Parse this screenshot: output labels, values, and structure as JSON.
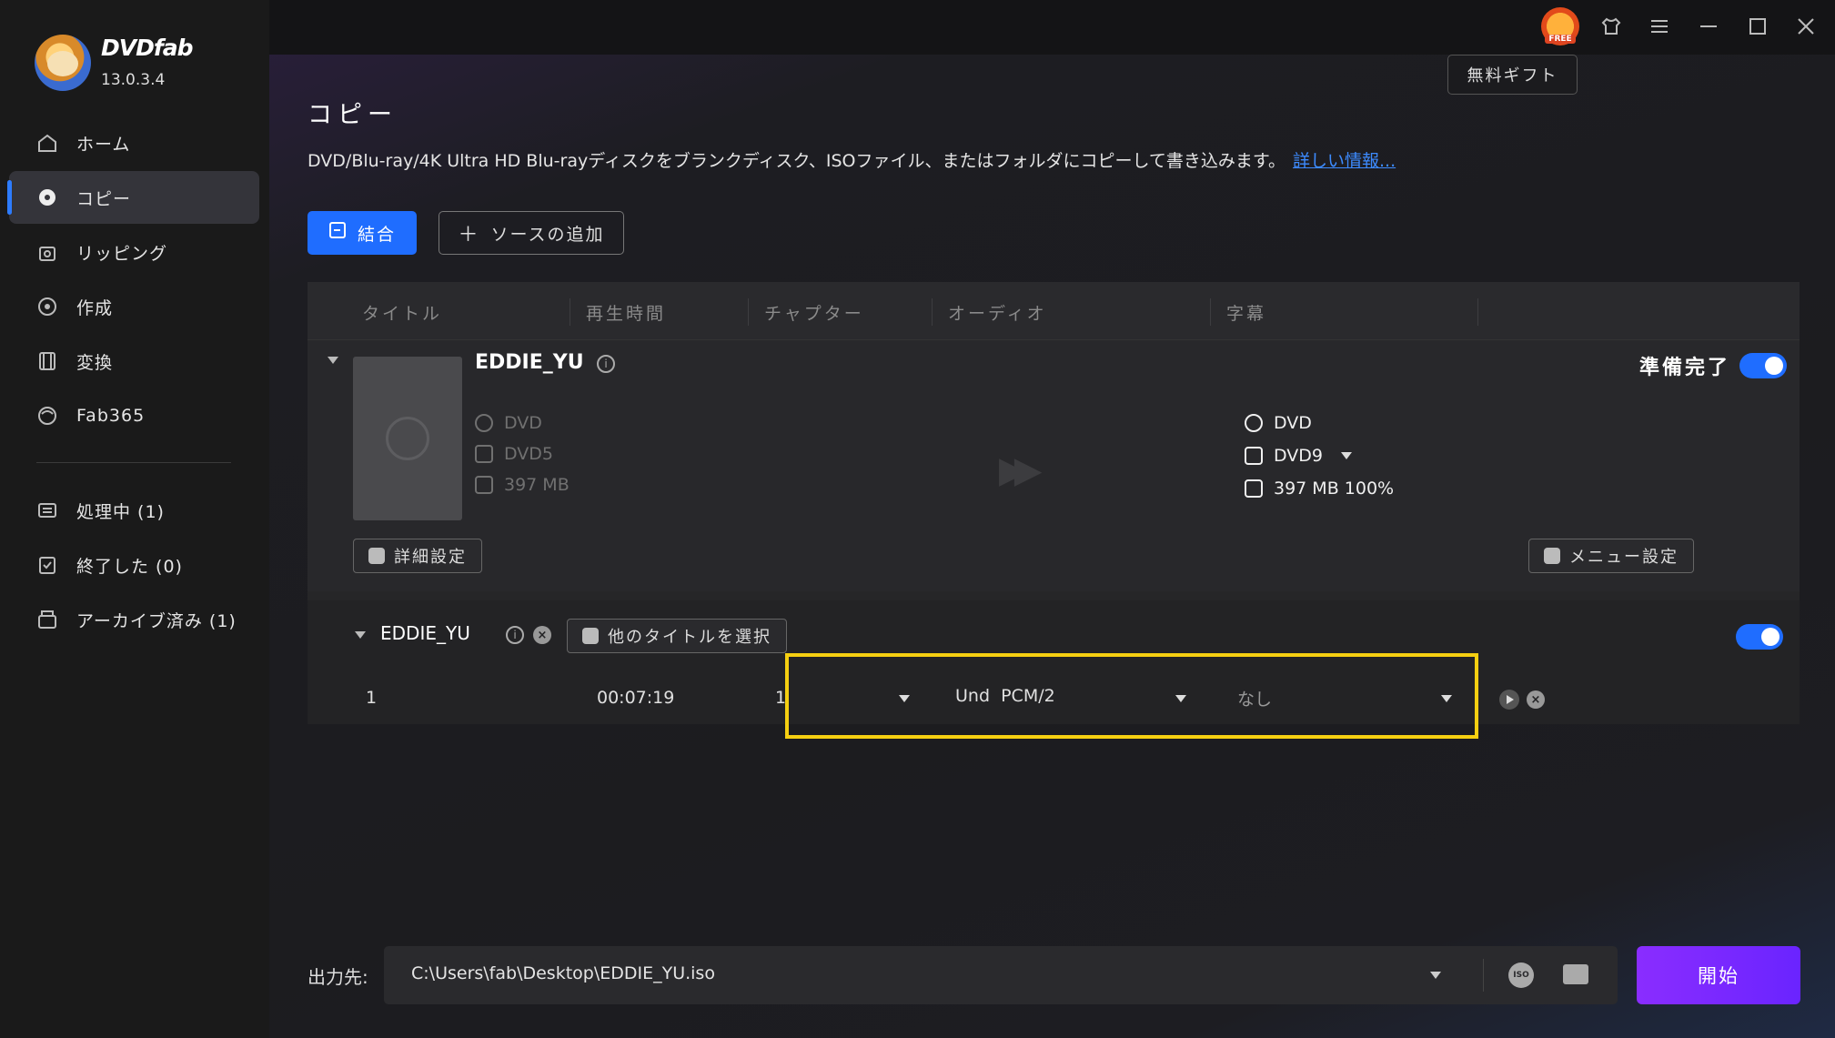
{
  "app": {
    "brand": "DVDfab",
    "version": "13.0.3.4"
  },
  "sidebar": {
    "items": [
      {
        "label": "ホーム",
        "icon": "home-icon"
      },
      {
        "label": "コピー",
        "icon": "copy-disc-icon"
      },
      {
        "label": "リッピング",
        "icon": "ripper-icon"
      },
      {
        "label": "作成",
        "icon": "creator-icon"
      },
      {
        "label": "変換",
        "icon": "converter-icon"
      },
      {
        "label": "Fab365",
        "icon": "fab365-icon"
      }
    ],
    "queue": [
      {
        "label": "処理中 (1)",
        "icon": "processing-icon"
      },
      {
        "label": "終了した (0)",
        "icon": "finished-icon"
      },
      {
        "label": "アーカイブ済み (1)",
        "icon": "archive-icon"
      }
    ]
  },
  "topbar": {
    "free_badge": "FREE",
    "gift_tooltip": "無料ギフト"
  },
  "page": {
    "title": "コピー",
    "description": "DVD/Blu-ray/4K Ultra HD Blu-rayディスクをブランクディスク、ISOファイル、またはフォルダにコピーして書き込みます。",
    "more_link": "詳しい情報..."
  },
  "actions": {
    "combine": "結合",
    "add_source": "ソースの追加"
  },
  "table": {
    "headers": [
      "タイトル",
      "再生時間",
      "チャプター",
      "オーディオ",
      "字幕"
    ]
  },
  "source": {
    "name": "EDDIE_YU",
    "input": {
      "type": "DVD",
      "disc": "DVD5",
      "size": "397 MB"
    },
    "output": {
      "type": "DVD",
      "disc": "DVD9",
      "size": "397 MB 100%"
    },
    "status": "準備完了",
    "advanced_btn": "詳細設定",
    "menu_btn": "メニュー設定"
  },
  "title_row": {
    "name": "EDDIE_YU",
    "select_other": "他のタイトルを選択",
    "index": "1",
    "duration": "00:07:19",
    "chapter": "1",
    "audio": "Und  PCM/2",
    "subtitle": "なし"
  },
  "output": {
    "label": "出力先:",
    "path": "C:\\Users\\fab\\Desktop\\EDDIE_YU.iso",
    "iso_label": "ISO"
  },
  "start_btn": "開始",
  "colors": {
    "accent": "#1f6dff",
    "start": "#7a29ff",
    "highlight": "#f5cf11"
  }
}
